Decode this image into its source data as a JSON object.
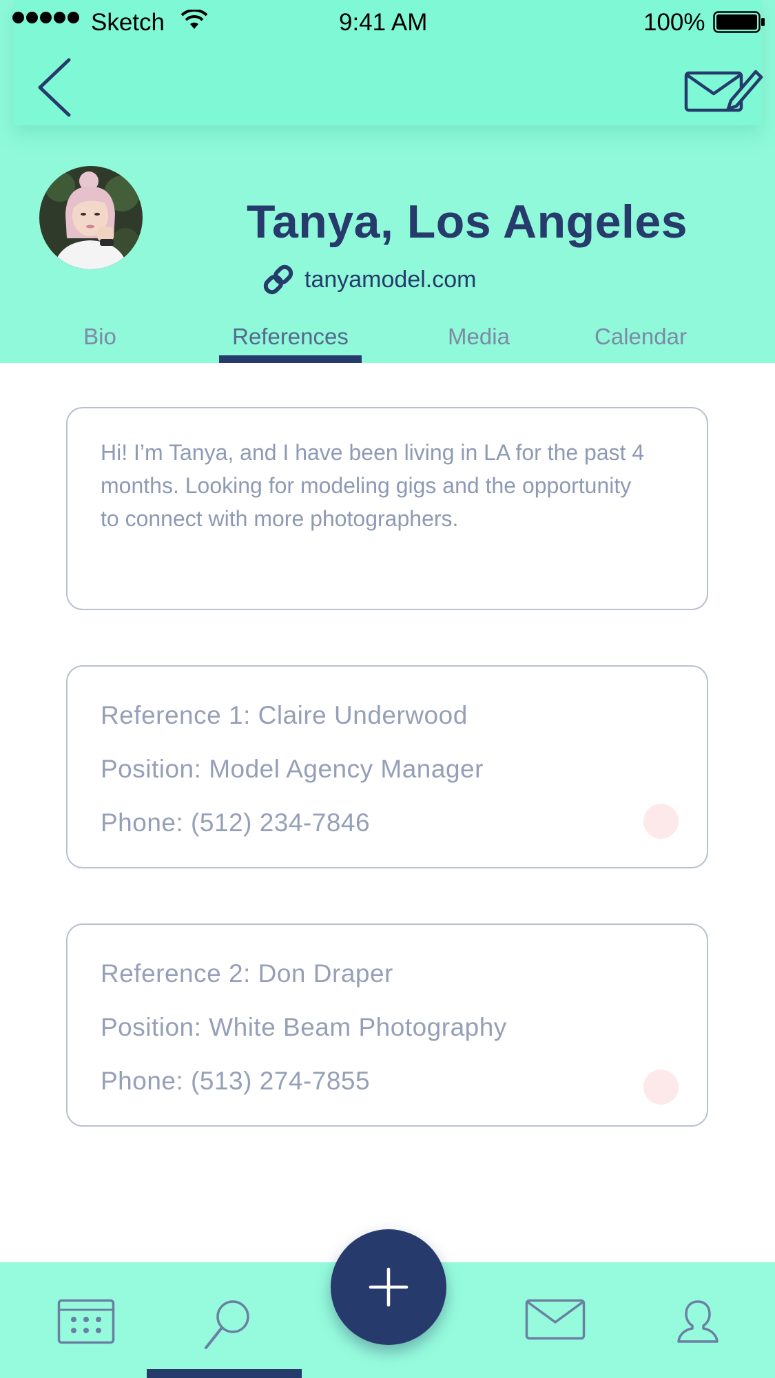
{
  "status_bar": {
    "carrier": "Sketch",
    "time": "9:41 AM",
    "battery": "100%"
  },
  "profile": {
    "name": "Tanya, Los Angeles",
    "website": "tanyamodel.com"
  },
  "tabs": [
    {
      "label": "Bio",
      "active": false
    },
    {
      "label": "References",
      "active": true
    },
    {
      "label": "Media",
      "active": false
    },
    {
      "label": "Calendar",
      "active": false
    }
  ],
  "bio": {
    "text": "Hi! I’m Tanya, and I have been living in LA for the past 4 months. Looking for modeling gigs and the opportunity to connect with more photographers."
  },
  "references": [
    {
      "title": "Reference 1: Claire Underwood",
      "position": "Position: Model Agency Manager",
      "phone": "Phone: (512) 234-7846"
    },
    {
      "title": "Reference 2: Don Draper",
      "position": "Position: White Beam Photography",
      "phone": "Phone: (513) 274-7855"
    }
  ],
  "bottom_nav": {
    "items": [
      "calendar-icon",
      "search-icon",
      "add-icon",
      "mail-icon",
      "profile-icon"
    ],
    "active": "search-icon"
  },
  "colors": {
    "header_bg": "#8ff9d9",
    "nav_bg": "#7ff9d5",
    "primary": "#263a6b",
    "tabbar_bg": "#96fbdd",
    "muted_text": "#959fb8",
    "indicator_dot": "#fde9ea"
  }
}
